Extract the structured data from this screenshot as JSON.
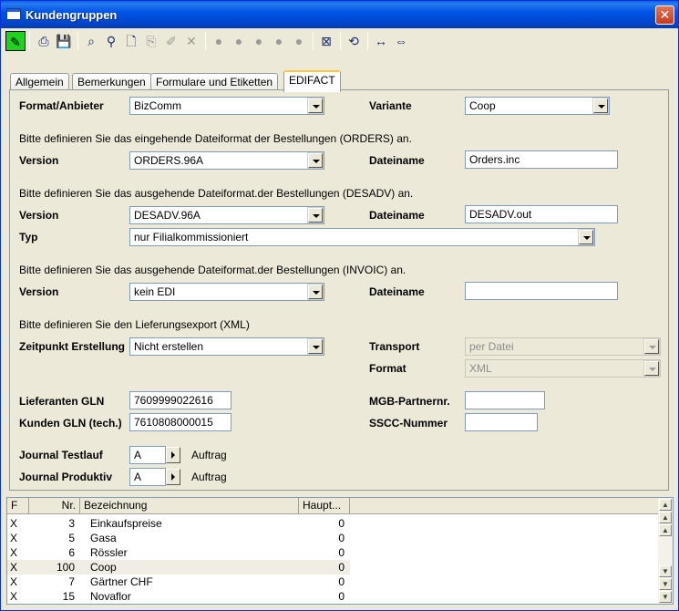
{
  "window": {
    "title": "Kundengruppen",
    "close": "✕"
  },
  "toolbar": {
    "buttons": [
      {
        "icon": "✎",
        "name": "edit-pencil-icon",
        "state": "active"
      },
      {
        "icon": "⎙",
        "name": "print-icon",
        "state": "enabled"
      },
      {
        "icon": "💾",
        "name": "save-icon",
        "state": "enabled"
      },
      {
        "icon": "⌕",
        "name": "binoculars-search-icon",
        "state": "enabled"
      },
      {
        "icon": "⚲",
        "name": "search-key-icon",
        "state": "enabled"
      },
      {
        "icon": "🗋",
        "name": "new-document-icon",
        "state": "enabled"
      },
      {
        "icon": "⎘",
        "name": "copy-icon",
        "state": "disabled"
      },
      {
        "icon": "✐",
        "name": "edit-disabled-icon",
        "state": "disabled"
      },
      {
        "icon": "✕",
        "name": "delete-icon",
        "state": "disabled"
      },
      {
        "icon": "●",
        "name": "record-first-icon",
        "state": "disabled"
      },
      {
        "icon": "●",
        "name": "record-prev-icon",
        "state": "disabled"
      },
      {
        "icon": "●",
        "name": "record-next-icon",
        "state": "disabled"
      },
      {
        "icon": "●",
        "name": "record-last-icon",
        "state": "disabled"
      },
      {
        "icon": "●",
        "name": "record-extra-icon",
        "state": "disabled"
      },
      {
        "icon": "⊠",
        "name": "filter-icon",
        "state": "enabled"
      },
      {
        "icon": "⟲",
        "name": "refresh-icon",
        "state": "enabled"
      },
      {
        "icon": "↔",
        "name": "expand-icon",
        "state": "enabled"
      },
      {
        "icon": "⇔",
        "name": "transfer-icon",
        "state": "enabled"
      }
    ]
  },
  "tabs": [
    {
      "label": "Allgemein",
      "selected": false
    },
    {
      "label": "Bemerkungen",
      "selected": false
    },
    {
      "label": "Formulare und Etiketten",
      "selected": false
    },
    {
      "label": "EDIFACT",
      "selected": true
    }
  ],
  "form": {
    "format_label": "Format/Anbieter",
    "format_value": "BizComm",
    "variante_label": "Variante",
    "variante_value": "Coop",
    "orders_info": "Bitte definieren Sie das eingehende Dateiformat der Bestellungen (ORDERS) an.",
    "orders_version_label": "Version",
    "orders_version_value": "ORDERS.96A",
    "orders_file_label": "Dateiname",
    "orders_file_value": "Orders.inc",
    "desadv_info": "Bitte definieren Sie das ausgehende Dateiformat.der Bestellungen (DESADV) an.",
    "desadv_version_label": "Version",
    "desadv_version_value": "DESADV.96A",
    "desadv_file_label": "Dateiname",
    "desadv_file_value": "DESADV.out",
    "typ_label": "Typ",
    "typ_value": "nur Filialkommissioniert",
    "invoic_info": "Bitte definieren Sie das ausgehende Dateiformat.der Bestellungen (INVOIC) an.",
    "invoic_version_label": "Version",
    "invoic_version_value": "kein EDI",
    "invoic_file_label": "Dateiname",
    "invoic_file_value": "",
    "xml_info": "Bitte definieren Sie den Lieferungsexport (XML)",
    "zeitpunkt_label": "Zeitpunkt Erstellung",
    "zeitpunkt_value": "Nicht erstellen",
    "transport_label": "Transport",
    "transport_value": "per Datei",
    "xml_format_label": "Format",
    "xml_format_value": "XML",
    "lieferanten_gln_label": "Lieferanten GLN",
    "lieferanten_gln_value": "7609999022616",
    "kunden_gln_label": "Kunden GLN (tech.)",
    "kunden_gln_value": "7610808000015",
    "mgb_label": "MGB-Partnernr.",
    "mgb_value": "",
    "sscc_label": "SSCC-Nummer",
    "sscc_value": "",
    "journal_test_label": "Journal Testlauf",
    "journal_test_value": "A",
    "journal_test_text": "Auftrag",
    "journal_prod_label": "Journal Produktiv",
    "journal_prod_value": "A",
    "journal_prod_text": "Auftrag"
  },
  "grid": {
    "columns": [
      "F",
      "Nr.",
      "Bezeichnung",
      "Haupt..."
    ],
    "rows": [
      {
        "f": "X",
        "nr": "3",
        "bez": "Einkaufspreise",
        "haupt": "0",
        "selected": false
      },
      {
        "f": "X",
        "nr": "5",
        "bez": "Gasa",
        "haupt": "0",
        "selected": false
      },
      {
        "f": "X",
        "nr": "6",
        "bez": "Rössler",
        "haupt": "0",
        "selected": false
      },
      {
        "f": "X",
        "nr": "100",
        "bez": "Coop",
        "haupt": "0",
        "selected": true
      },
      {
        "f": "X",
        "nr": "7",
        "bez": "Gärtner CHF",
        "haupt": "0",
        "selected": false
      },
      {
        "f": "X",
        "nr": "15",
        "bez": "Novaflor",
        "haupt": "0",
        "selected": false
      }
    ]
  },
  "colors": {
    "title_blue": "#0055E5",
    "active_green": "#1ED21E",
    "tab_highlight": "#FFC83C",
    "face": "#ECE9D8"
  }
}
